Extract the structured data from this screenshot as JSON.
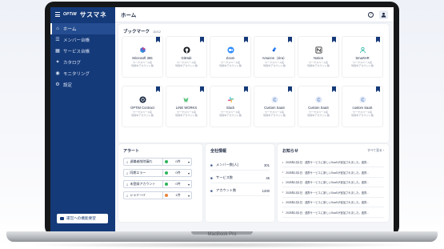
{
  "app": {
    "logo": "OPTiM",
    "name": "サスマネ"
  },
  "sidebar": {
    "items": [
      {
        "label": "ホーム",
        "icon": "home-icon",
        "glyph": "⌂"
      },
      {
        "label": "メンバー台帳",
        "icon": "people-icon",
        "glyph": "☰"
      },
      {
        "label": "サービス台帳",
        "icon": "services-icon",
        "glyph": "▦"
      },
      {
        "label": "カタログ",
        "icon": "catalog-icon",
        "glyph": "✦"
      },
      {
        "label": "モニタリング",
        "icon": "monitoring-icon",
        "glyph": "◉"
      },
      {
        "label": "設定",
        "icon": "gear-icon",
        "glyph": "⚙"
      }
    ],
    "feature_request": "運営への機能要望"
  },
  "header": {
    "title": "ホーム",
    "help": "?"
  },
  "bookmarks": {
    "title": "ブックマーク",
    "count": "10/12",
    "items": [
      {
        "name": "Microsoft 365",
        "meta1": "ワークスペース名",
        "meta2": "利用中アカウント数",
        "icon": "microsoft-365-icon"
      },
      {
        "name": "GitHub",
        "meta1": "ワークスペース名",
        "meta2": "利用中アカウント数",
        "icon": "github-icon"
      },
      {
        "name": "Zoom",
        "meta1": "ワークスペース名",
        "meta2": "利用中アカウント数",
        "icon": "zoom-icon"
      },
      {
        "name": "Amazon（Jira）",
        "meta1": "ワークスペース名",
        "meta2": "利用中アカウント数",
        "icon": "jira-icon"
      },
      {
        "name": "Notion",
        "meta1": "ワークスペース名",
        "meta2": "利用中アカウント数",
        "icon": "notion-icon"
      },
      {
        "name": "SmartHR",
        "meta1": "ワークスペース名",
        "meta2": "利用中アカウント数",
        "icon": "smarthr-icon"
      },
      {
        "name": "OPTiM Contract",
        "meta1": "ワークスペース名",
        "meta2": "利用中アカウント数",
        "icon": "optim-contract-icon"
      },
      {
        "name": "LINE WORKS",
        "meta1": "ワークスペース名",
        "meta2": "利用中アカウント数",
        "icon": "line-works-icon"
      },
      {
        "name": "Slack",
        "meta1": "ワークスペース名",
        "meta2": "利用中アカウント数",
        "icon": "slack-icon"
      },
      {
        "name": "Custom SaaS",
        "meta1": "ワークスペース名",
        "meta2": "利用中アカウント数",
        "icon": "custom-saas-icon"
      },
      {
        "name": "Custom SaaS",
        "meta1": "ワークスペース名",
        "meta2": "利用中アカウント数",
        "icon": "custom-saas-icon"
      },
      {
        "name": "custom SaaS",
        "meta1": "ワークスペース名",
        "meta2": "利用中アカウント数",
        "icon": "custom-saas-icon"
      }
    ]
  },
  "alerts": {
    "title": "アラート",
    "items": [
      {
        "label": "退職者削除漏れ",
        "count": "0件",
        "color": "#2fb45a"
      },
      {
        "label": "同期エラー",
        "count": "0件",
        "color": "#2fb45a"
      },
      {
        "label": "未登録アカウント",
        "count": "0件",
        "color": "#2fb45a"
      },
      {
        "label": "シャドーIT",
        "count": "1件",
        "color": "#e8833a"
      }
    ]
  },
  "overview": {
    "title": "全社情報",
    "items": [
      {
        "label": "メンバー数(人)",
        "value": "301"
      },
      {
        "label": "サービス数",
        "value": "45"
      },
      {
        "label": "アカウント数",
        "value": "1200"
      }
    ]
  },
  "news": {
    "title": "お知らせ",
    "more": "すべて見る",
    "items": [
      {
        "date": "2025年1月1日",
        "text": "連携サービスに新しいSaaSが追加されました。連携..."
      },
      {
        "date": "2025年1月1日",
        "text": "連携サービスに新しいSaaSが追加されました。連携..."
      },
      {
        "date": "2025年1月1日",
        "text": "連携サービスに新しいSaaSが追加されました。連携..."
      },
      {
        "date": "2025年1月1日",
        "text": "連携サービスに新しいSaaSが追加されました。連携..."
      },
      {
        "date": "2025年1月1日",
        "text": "連携サービスに新しいSaaSが追加されました。連携..."
      },
      {
        "date": "2025年1月1日",
        "text": "連携サービスに新しいSaaSが追加されました。連携..."
      }
    ]
  },
  "device": {
    "label": "MacBook Pro"
  },
  "colors": {
    "sidebar": "#153a79",
    "accent": "#153a79",
    "ok": "#2fb45a",
    "warn": "#e8833a"
  }
}
